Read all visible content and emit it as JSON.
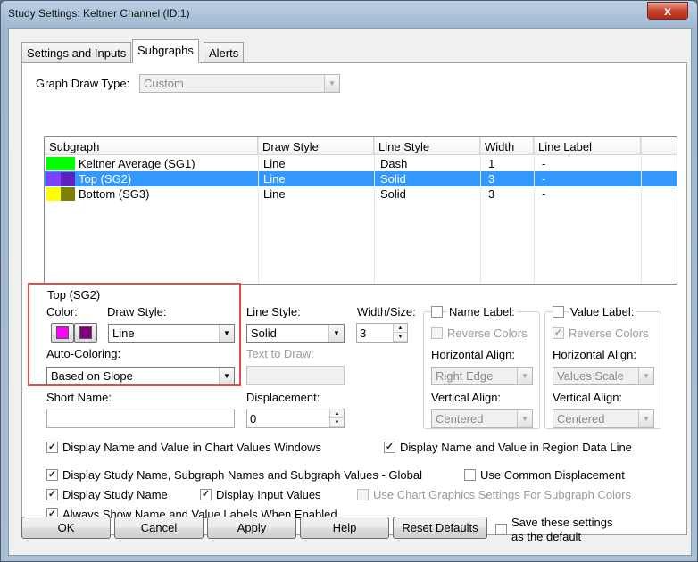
{
  "window": {
    "title": "Study Settings: Keltner Channel (ID:1)",
    "close_glyph": "x"
  },
  "tabs": [
    {
      "label": "Settings and Inputs"
    },
    {
      "label": "Subgraphs"
    },
    {
      "label": "Alerts"
    }
  ],
  "graph_draw_type": {
    "label": "Graph Draw Type:",
    "value": "Custom"
  },
  "grid": {
    "columns": [
      "Subgraph",
      "Draw Style",
      "Line Style",
      "Width",
      "Line Label"
    ],
    "rows": [
      {
        "name": "Keltner Average (SG1)",
        "draw_style": "Line",
        "line_style": "Dash",
        "width": "1",
        "line_label": "-",
        "color1": "#00ff00",
        "color2": "#00ff00",
        "selected": false
      },
      {
        "name": "Top (SG2)",
        "draw_style": "Line",
        "line_style": "Solid",
        "width": "3",
        "line_label": "-",
        "color1": "#8040ff",
        "color2": "#6020c0",
        "selected": true
      },
      {
        "name": "Bottom (SG3)",
        "draw_style": "Line",
        "line_style": "Solid",
        "width": "3",
        "line_label": "-",
        "color1": "#ffff00",
        "color2": "#808000",
        "selected": false
      }
    ]
  },
  "detail": {
    "group_title": "Top (SG2)",
    "color_label": "Color:",
    "color1": "#ff00ff",
    "color2": "#800080",
    "draw_style_label": "Draw Style:",
    "draw_style_value": "Line",
    "auto_coloring_label": "Auto-Coloring:",
    "auto_coloring_value": "Based on Slope",
    "line_style_label": "Line Style:",
    "line_style_value": "Solid",
    "text_to_draw_label": "Text to Draw:",
    "width_label": "Width/Size:",
    "width_value": "3",
    "short_name_label": "Short Name:",
    "short_name_value": "",
    "displacement_label": "Displacement:",
    "displacement_value": "0",
    "name_label": {
      "label": "Name Label:",
      "reverse_colors": "Reverse Colors",
      "h_align_label": "Horizontal Align:",
      "h_align_value": "Right Edge",
      "v_align_label": "Vertical Align:",
      "v_align_value": "Centered"
    },
    "value_label": {
      "label": "Value Label:",
      "reverse_colors": "Reverse Colors",
      "h_align_label": "Horizontal Align:",
      "h_align_value": "Values Scale",
      "v_align_label": "Vertical Align:",
      "v_align_value": "Centered"
    },
    "display_chart_values": "Display Name and Value in Chart Values Windows",
    "display_region_data": "Display Name and Value in Region Data Line"
  },
  "options": {
    "global": "Display Study Name, Subgraph Names and Subgraph Values - Global",
    "common_displacement": "Use Common Displacement",
    "study_name": "Display Study Name",
    "input_values": "Display Input Values",
    "chart_graphics": "Use Chart Graphics Settings For Subgraph Colors",
    "always_show": "Always Show Name and Value Labels When Enabled"
  },
  "buttons": {
    "ok": "OK",
    "cancel": "Cancel",
    "apply": "Apply",
    "help": "Help",
    "reset": "Reset Defaults",
    "save_default": "Save these settings as the default"
  },
  "highlight_color": "#e84a4a"
}
